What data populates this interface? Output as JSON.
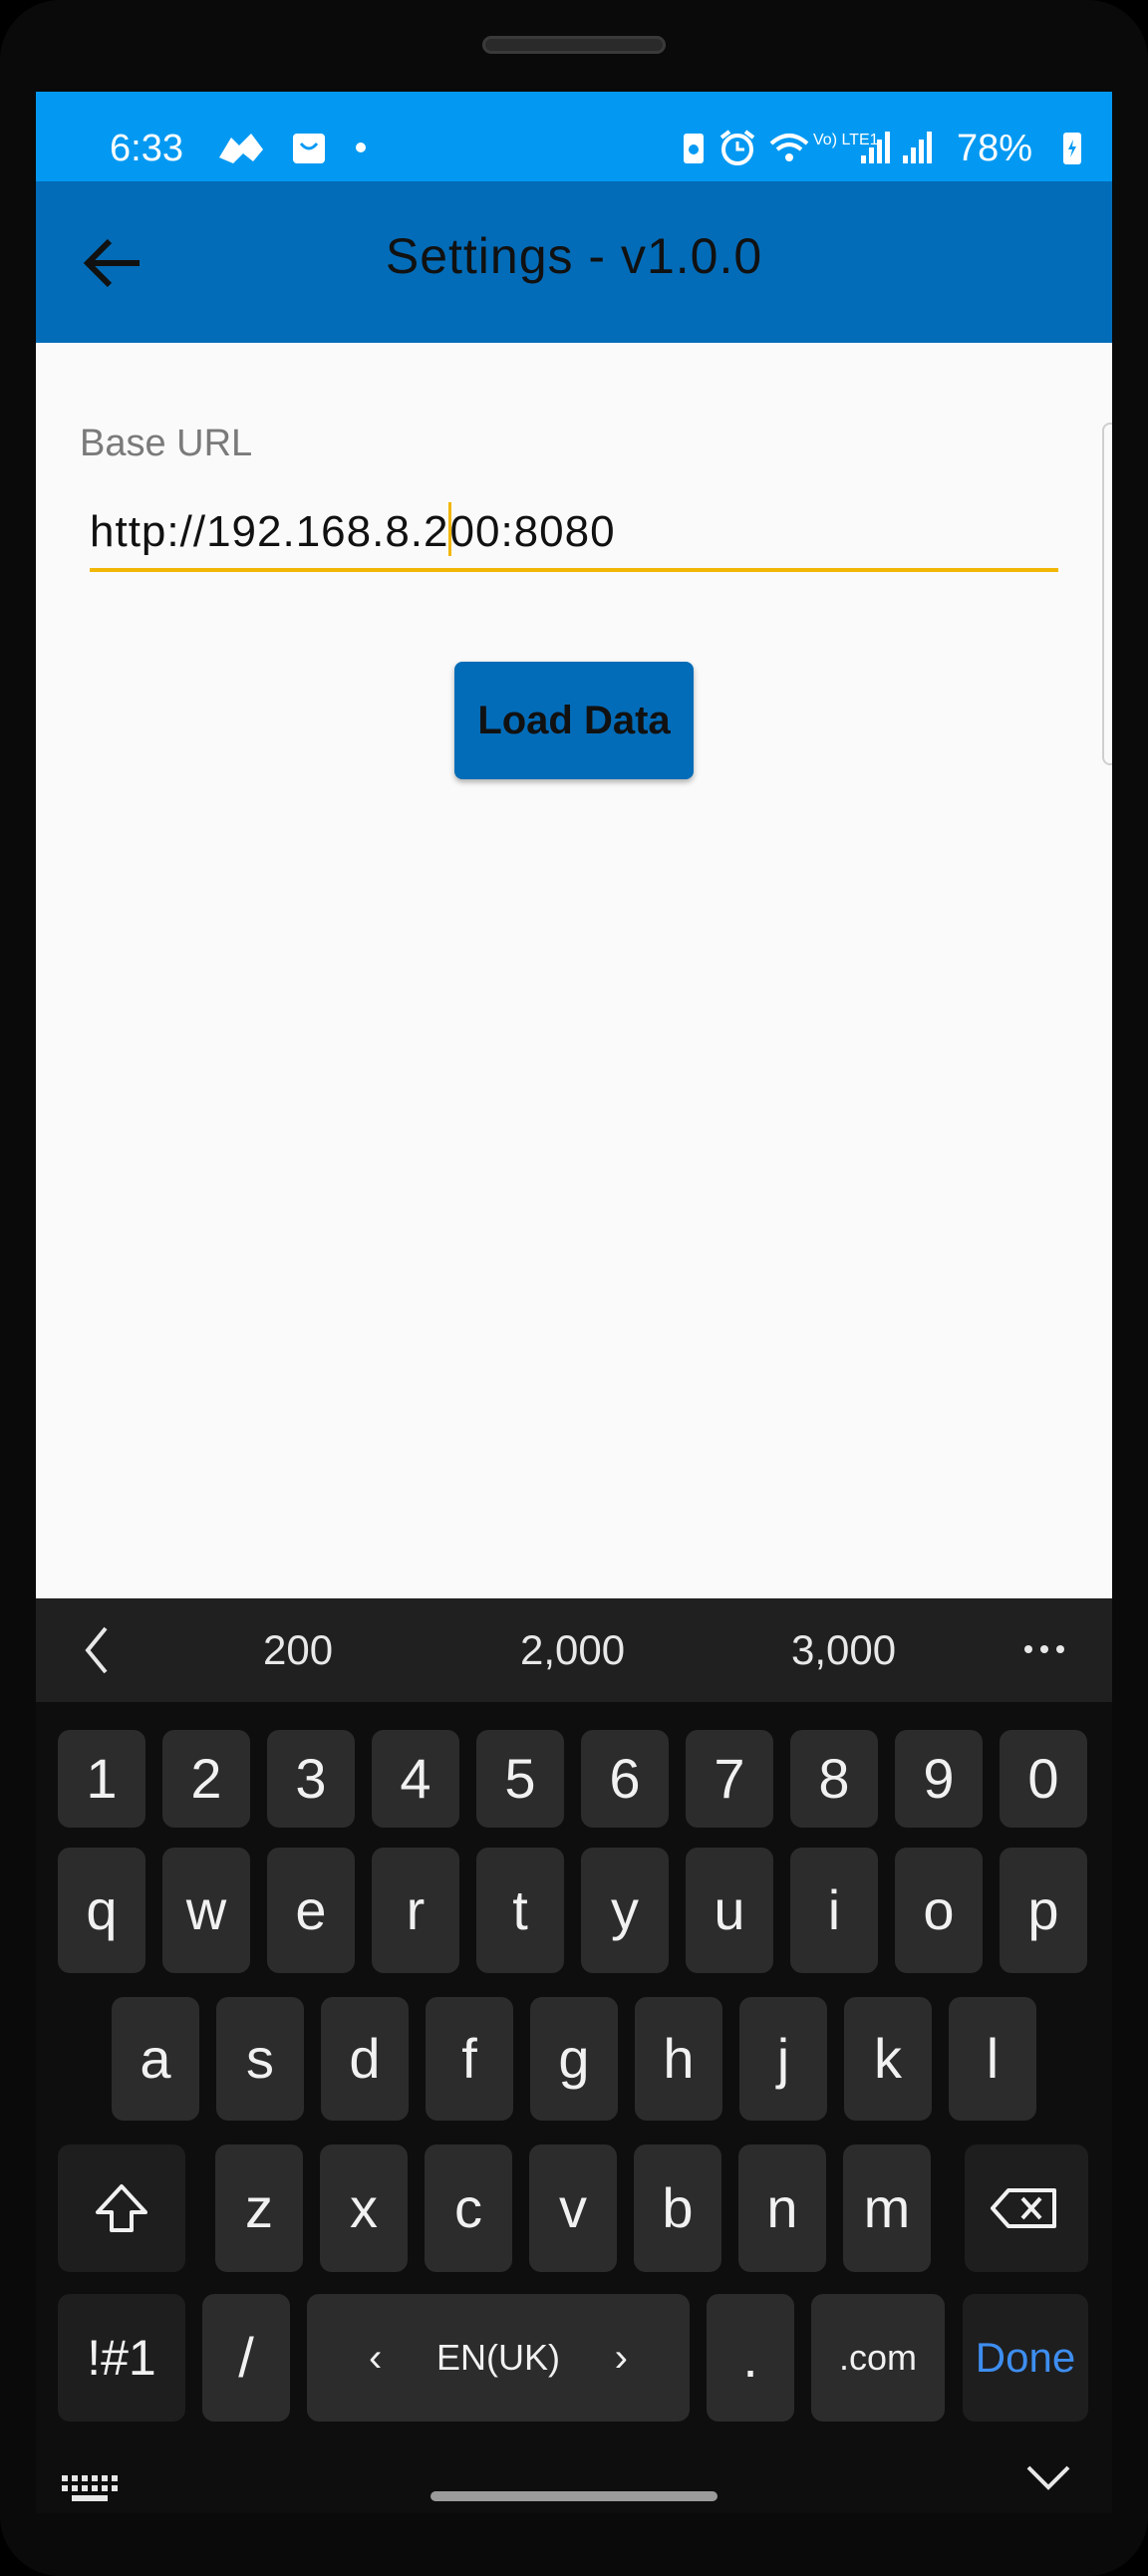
{
  "status_bar": {
    "time": "6:33",
    "battery_pct": "78%",
    "network_label": "Vo) LTE1"
  },
  "app_bar": {
    "title": "Settings - v1.0.0",
    "back_icon": "arrow-left-icon"
  },
  "form": {
    "label": "Base URL",
    "value_before_caret": "http://192.168.8.2",
    "value_after_caret": "00:8080",
    "accent": "#f2b705"
  },
  "load_button_label": "Load Data",
  "keyboard": {
    "suggestions": [
      "200",
      "2,000",
      "3,000"
    ],
    "row_numbers": [
      "1",
      "2",
      "3",
      "4",
      "5",
      "6",
      "7",
      "8",
      "9",
      "0"
    ],
    "row1": [
      "q",
      "w",
      "e",
      "r",
      "t",
      "y",
      "u",
      "i",
      "o",
      "p"
    ],
    "row2": [
      "a",
      "s",
      "d",
      "f",
      "g",
      "h",
      "j",
      "k",
      "l"
    ],
    "row3": [
      "z",
      "x",
      "c",
      "v",
      "b",
      "n",
      "m"
    ],
    "symbols_label": "!#1",
    "slash_label": "/",
    "language_label": "EN(UK)",
    "period_label": ".",
    "dotcom_label": ".com",
    "done_label": "Done"
  },
  "colors": {
    "status_bar": "#0399f2",
    "app_bar": "#036cb8",
    "button": "#036cb8",
    "done_text": "#3e8ef0"
  }
}
